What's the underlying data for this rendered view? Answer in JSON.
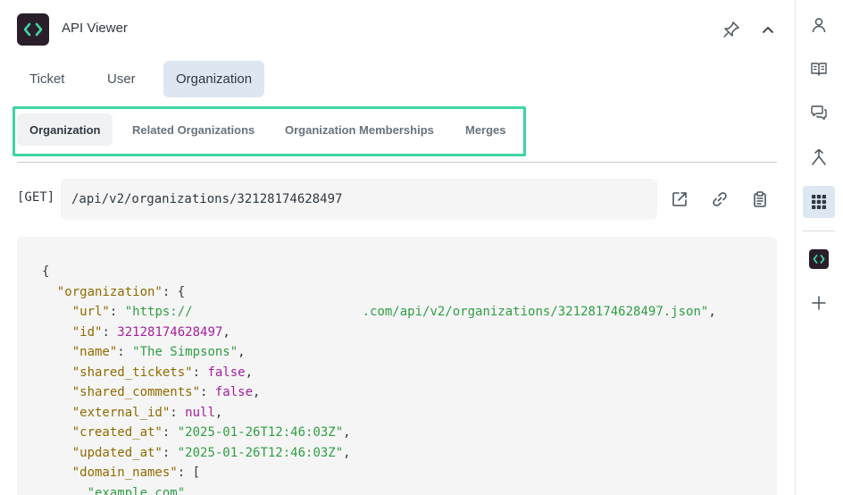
{
  "app": {
    "title": "API Viewer"
  },
  "header": {
    "pin_icon": "pin-icon",
    "collapse_icon": "chevron-up-icon"
  },
  "primary_tabs": [
    {
      "label": "Ticket",
      "active": false
    },
    {
      "label": "User",
      "active": false
    },
    {
      "label": "Organization",
      "active": true
    }
  ],
  "sub_tabs": [
    {
      "label": "Organization",
      "active": true
    },
    {
      "label": "Related Organizations",
      "active": false
    },
    {
      "label": "Organization Memberships",
      "active": false
    },
    {
      "label": "Merges",
      "active": false
    }
  ],
  "request": {
    "method": "[GET]",
    "url": "/api/v2/organizations/32128174628497",
    "actions": [
      "external-link-icon",
      "link-icon",
      "clipboard-icon"
    ]
  },
  "json": {
    "open_brace": "{",
    "root_key": "\"organization\"",
    "root_open": ": {",
    "lines": [
      {
        "key": "\"url\"",
        "prefix": "\"https://",
        "suffix": ".com/api/v2/organizations/32128174628497.json\"",
        "type": "string-redacted"
      },
      {
        "key": "\"id\"",
        "value": "32128174628497",
        "type": "number"
      },
      {
        "key": "\"name\"",
        "value": "\"The Simpsons\"",
        "type": "string"
      },
      {
        "key": "\"shared_tickets\"",
        "value": "false",
        "type": "bool"
      },
      {
        "key": "\"shared_comments\"",
        "value": "false",
        "type": "bool"
      },
      {
        "key": "\"external_id\"",
        "value": "null",
        "type": "bool"
      },
      {
        "key": "\"created_at\"",
        "value": "\"2025-01-26T12:46:03Z\"",
        "type": "string"
      },
      {
        "key": "\"updated_at\"",
        "value": "\"2025-01-26T12:46:03Z\"",
        "type": "string"
      },
      {
        "key": "\"domain_names\"",
        "value": "[",
        "type": "open"
      }
    ],
    "array_item": "\"example.com\""
  },
  "rail": [
    "user-icon",
    "book-icon",
    "chat-icon",
    "merge-icon",
    "apps-grid-icon",
    "api-viewer-app-icon",
    "plus-icon"
  ],
  "colors": {
    "accent_frame": "#3ed5a0",
    "active_tab": "#dde7f2",
    "app_icon_bg": "#2b1e2b",
    "app_icon_fg": "#3ed5a0"
  }
}
